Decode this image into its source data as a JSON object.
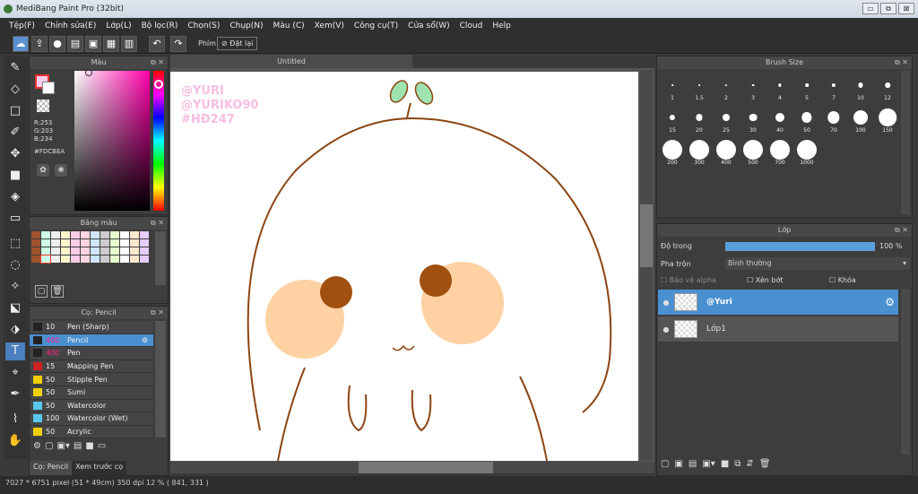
{
  "window": {
    "title": "MediBang Paint Pro (32bit)",
    "buttons": [
      "▭",
      "⧉",
      "⊠"
    ]
  },
  "menu": [
    "Tệp(F)",
    "Chỉnh sửa(E)",
    "Lớp(L)",
    "Bộ lọc(R)",
    "Chọn(S)",
    "Chụp(N)",
    "Màu (C)",
    "Xem(V)",
    "Công cụ(T)",
    "Cửa sổ(W)",
    "Cloud",
    "Help"
  ],
  "toolbar": {
    "key_label": "Phím",
    "reset_label": "Đặt lại"
  },
  "color_panel": {
    "title": "Màu",
    "r": "R:253",
    "g": "G:203",
    "b": "B:234",
    "hex": "#FDCBEA",
    "primary": "#FDCBEA"
  },
  "palette_panel": {
    "title": "Bảng màu"
  },
  "brush_panel": {
    "title": "Cọ: Pencil",
    "items": [
      {
        "size": "10",
        "name": "Pen (Sharp)",
        "color": "#222222",
        "selected": false
      },
      {
        "size": "400",
        "name": "Pencil",
        "color": "#222222",
        "selected": true
      },
      {
        "size": "400",
        "name": "Pen",
        "color": "#222222",
        "selected": false
      },
      {
        "size": "15",
        "name": "Mapping Pen",
        "color": "#cc2222",
        "selected": false
      },
      {
        "size": "50",
        "name": "Stipple Pen",
        "color": "#f0d000",
        "selected": false
      },
      {
        "size": "50",
        "name": "Sumi",
        "color": "#f0d000",
        "selected": false
      },
      {
        "size": "50",
        "name": "Watercolor",
        "color": "#58c8f0",
        "selected": false
      },
      {
        "size": "100",
        "name": "Watercolor (Wet)",
        "color": "#58c8f0",
        "selected": false
      },
      {
        "size": "50",
        "name": "Acrylic",
        "color": "#f0d000",
        "selected": false
      }
    ],
    "tab1": "Cọ: Pencil",
    "tab2": "Xem trước cọ"
  },
  "canvas": {
    "tab": "Untitled",
    "watermark": [
      "@YURI",
      "@YURIKO90",
      "#HĐ247"
    ]
  },
  "brush_size": {
    "title": "Brush Size",
    "row1": [
      "1",
      "1.5",
      "2",
      "3",
      "4",
      "5",
      "7",
      "10",
      "12"
    ],
    "row2": [
      "15",
      "20",
      "25",
      "30",
      "40",
      "50",
      "70",
      "100",
      "150"
    ],
    "row3": [
      "200",
      "300",
      "400",
      "500",
      "700",
      "1000"
    ]
  },
  "layer_panel": {
    "title": "Lớp",
    "opacity_label": "Độ trong",
    "opacity_value": "100 %",
    "blend_label": "Pha trộn",
    "blend_value": "Bình thường",
    "protect_alpha": "Bảo vệ alpha",
    "clipping": "Xén bớt",
    "lock": "Khóa",
    "layers": [
      {
        "name": "@Yuri",
        "selected": true
      },
      {
        "name": "Lớp1",
        "selected": false
      }
    ]
  },
  "status": "7027 * 6751 pixel  (51 * 49cm)  350 dpi  12 %  ( 841, 331 )"
}
